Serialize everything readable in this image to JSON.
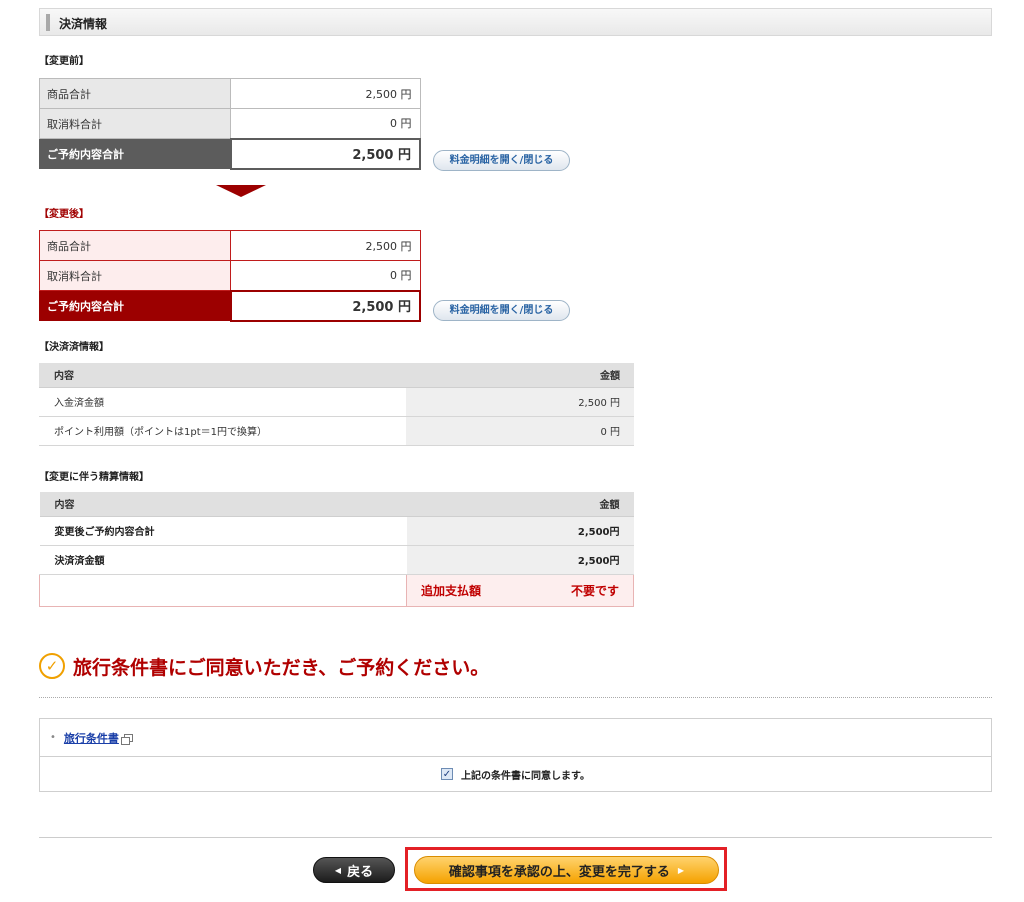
{
  "section": {
    "title": "決済情報"
  },
  "before": {
    "label": "【変更前】",
    "rows": [
      {
        "label": "商品合計",
        "value": "2,500 円"
      },
      {
        "label": "取消料合計",
        "value": "0 円"
      }
    ],
    "total": {
      "label": "ご予約内容合計",
      "value": "2,500 円"
    },
    "toggle_label": "料金明細を開く/閉じる"
  },
  "after": {
    "label": "【変更後】",
    "rows": [
      {
        "label": "商品合計",
        "value": "2,500 円"
      },
      {
        "label": "取消料合計",
        "value": "0 円"
      }
    ],
    "total": {
      "label": "ご予約内容合計",
      "value": "2,500 円"
    },
    "toggle_label": "料金明細を開く/閉じる"
  },
  "paid": {
    "label": "【決済済情報】",
    "headers": [
      "内容",
      "金額"
    ],
    "rows": [
      {
        "item": "入金済金額",
        "amount": "2,500 円"
      },
      {
        "item": "ポイント利用額（ポイントは1pt＝1円で換算）",
        "amount": "0 円"
      }
    ]
  },
  "settle": {
    "label": "【変更に伴う精算情報】",
    "headers": [
      "内容",
      "金額"
    ],
    "rows": [
      {
        "item": "変更後ご予約内容合計",
        "amount": "2,500円"
      },
      {
        "item": "決済済金額",
        "amount": "2,500円"
      }
    ],
    "extra_label": "追加支払額",
    "extra_value": "不要です"
  },
  "agreement": {
    "title": "旅行条件書にご同意いただき、ご予約ください。",
    "terms_link": "旅行条件書",
    "checkbox_label": "上記の条件書に同意します。",
    "checked": true
  },
  "buttons": {
    "back": "戻る",
    "confirm": "確認事項を承認の上、変更を完了する"
  },
  "colors": {
    "accent_red": "#9c0000",
    "highlight": "#e32026",
    "confirm": "#f5a200"
  }
}
